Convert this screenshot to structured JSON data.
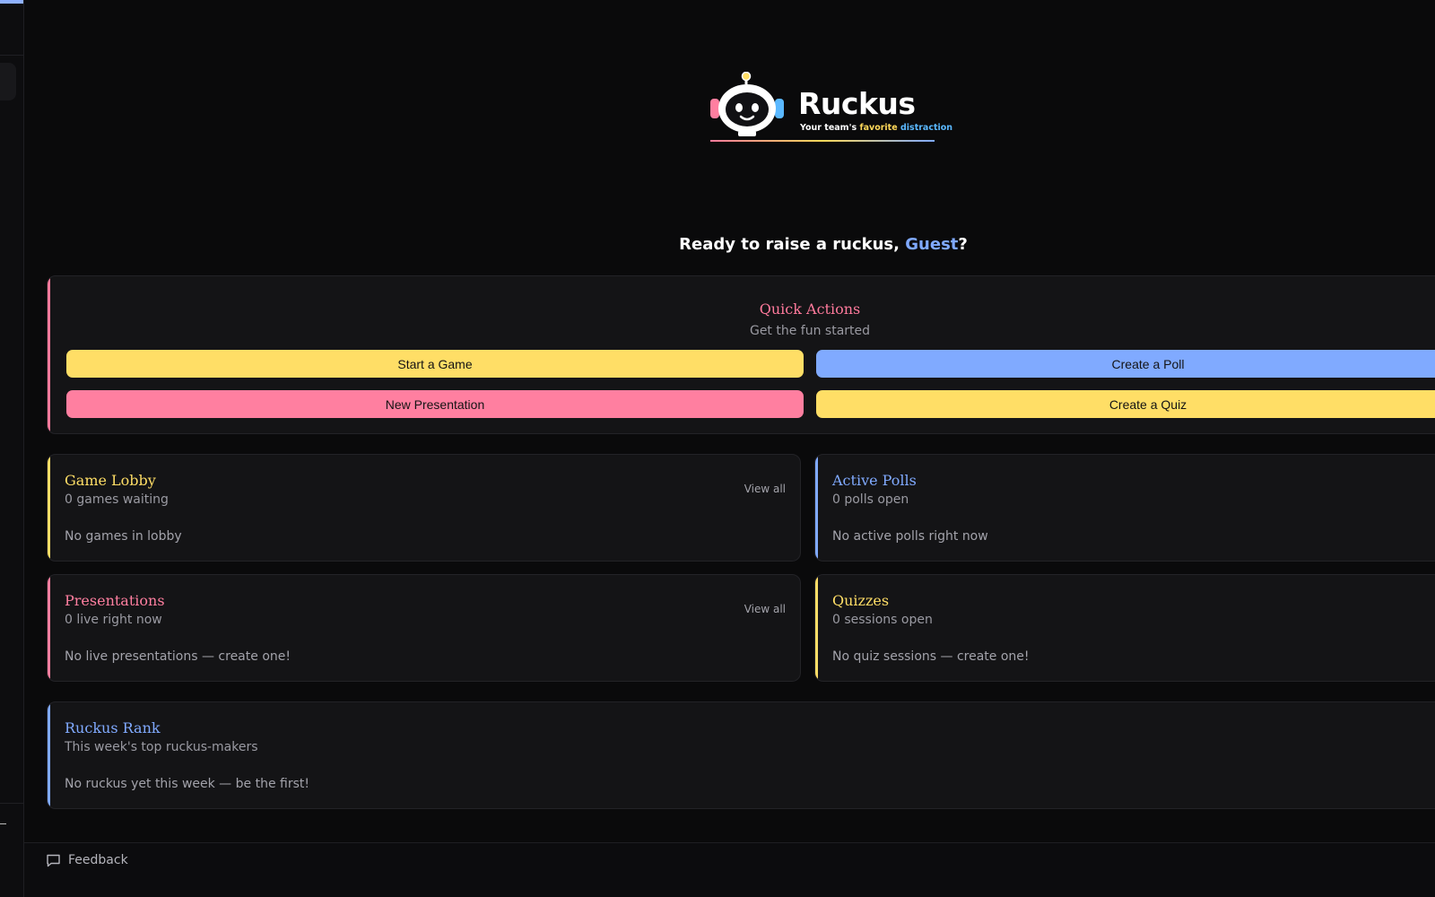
{
  "brand": {
    "name": "Ruckus",
    "tagline_start": "Your team's ",
    "tagline_fav": "favorite",
    "tagline_space": " ",
    "tagline_dis": "distraction",
    "colors": {
      "pink": "#ff7a9c",
      "yellow": "#ffde66",
      "blue": "#80aaff"
    }
  },
  "greeting": {
    "prefix": "Ready to raise a ruckus, ",
    "name": "Guest",
    "suffix": "?"
  },
  "quick_actions": {
    "title": "Quick Actions",
    "subtitle": "Get the fun started",
    "buttons": [
      "Start a Game",
      "Create a Poll",
      "New Presentation",
      "Create a Quiz"
    ]
  },
  "cards": {
    "game_lobby": {
      "title": "Game Lobby",
      "subtitle": "0 games waiting",
      "empty": "No games in lobby",
      "link": "View all"
    },
    "active_polls": {
      "title": "Active Polls",
      "subtitle": "0 polls open",
      "empty": "No active polls right now"
    },
    "presentations": {
      "title": "Presentations",
      "subtitle": "0 live right now",
      "empty": "No live presentations — create one!",
      "link": "View all"
    },
    "quizzes": {
      "title": "Quizzes",
      "subtitle": "0 sessions open",
      "empty": "No quiz sessions — create one!"
    },
    "rank": {
      "title": "Ruckus Rank",
      "subtitle": "This week's top ruckus-makers",
      "empty": "No ruckus yet this week — be the first!"
    }
  },
  "footer": {
    "feedback_label": "Feedback",
    "icon": "chat-bubble-icon"
  }
}
